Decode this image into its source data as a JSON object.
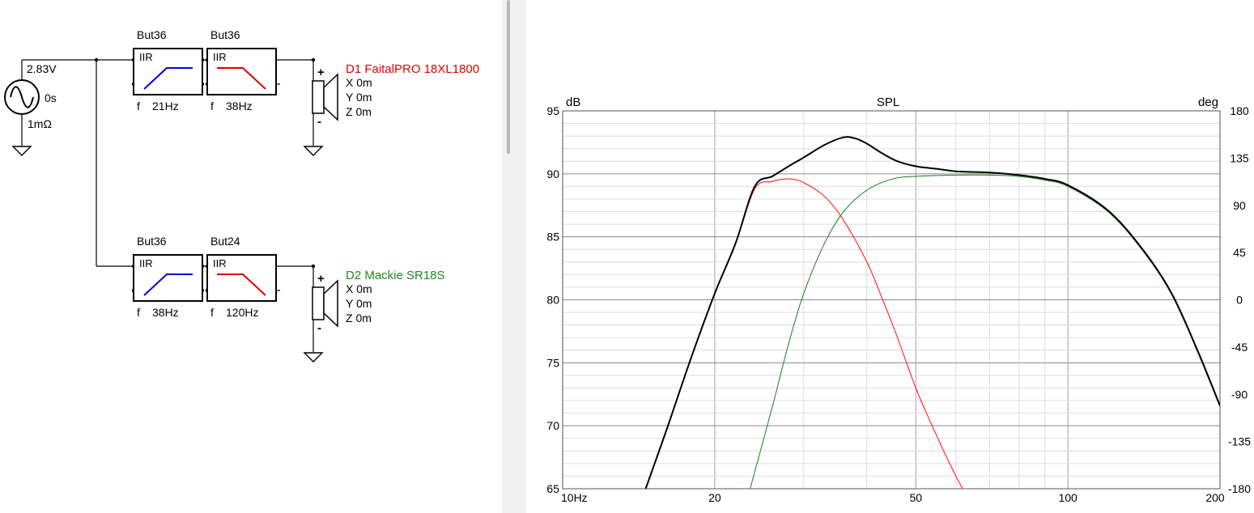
{
  "source": {
    "voltage": "2.83V",
    "delay": "0s",
    "impedance": "1mΩ"
  },
  "channels": [
    {
      "filters": [
        {
          "name": "But36",
          "type": "IIR",
          "shape": "highpass",
          "freq_label": "f",
          "freq": "21Hz"
        },
        {
          "name": "But36",
          "type": "IIR",
          "shape": "lowpass",
          "freq_label": "f",
          "freq": "38Hz"
        }
      ],
      "driver": {
        "label": "D1 FaitalPRO 18XL1800",
        "color": "#e00000",
        "x": "X 0m",
        "y": "Y 0m",
        "z": "Z 0m",
        "plus": "+",
        "minus": "-"
      }
    },
    {
      "filters": [
        {
          "name": "But36",
          "type": "IIR",
          "shape": "highpass",
          "freq_label": "f",
          "freq": "38Hz"
        },
        {
          "name": "But24",
          "type": "IIR",
          "shape": "lowpass",
          "freq_label": "f",
          "freq": "120Hz"
        }
      ],
      "driver": {
        "label": "D2 Mackie SR18S",
        "color": "#1e8a1e",
        "x": "X 0m",
        "y": "Y 0m",
        "z": "Z 0m",
        "plus": "+",
        "minus": "-"
      }
    }
  ],
  "colors": {
    "highpass": "#0000dd",
    "lowpass": "#dd0000",
    "sum": "#000000",
    "d1": "#ff2020",
    "d2": "#2a8a2a"
  },
  "chart_data": {
    "type": "line",
    "title": "SPL",
    "ylabel": "dB",
    "y2label": "deg",
    "xscale": "log",
    "xlim": [
      10,
      200
    ],
    "ylim": [
      65,
      95
    ],
    "y2lim": [
      -180,
      180
    ],
    "xticks": [
      {
        "v": 10,
        "label": "10Hz"
      },
      {
        "v": 20,
        "label": "20"
      },
      {
        "v": 50,
        "label": "50"
      },
      {
        "v": 100,
        "label": "100"
      },
      {
        "v": 200,
        "label": "200"
      }
    ],
    "yticks": [
      95,
      90,
      85,
      80,
      75,
      70,
      65
    ],
    "y2ticks": [
      "180",
      "135",
      "90",
      "45",
      "0",
      "-45",
      "-90",
      "-135",
      "-180"
    ],
    "grid": true,
    "series": [
      {
        "key": "d1",
        "x": [
          14.6,
          16,
          18,
          20,
          22,
          24,
          26,
          28,
          30,
          33,
          36,
          40,
          43,
          46,
          50,
          55,
          60,
          63
        ],
        "y": [
          65,
          69.5,
          75.5,
          80.5,
          84.5,
          88.8,
          89.4,
          89.6,
          89.3,
          88.2,
          86.3,
          83,
          80,
          77,
          73,
          69.2,
          66,
          64.5
        ]
      },
      {
        "key": "d2",
        "x": [
          23.5,
          26,
          28,
          30,
          33,
          36,
          40,
          45,
          50,
          60,
          70,
          80,
          90,
          100,
          120,
          140,
          160,
          180,
          200
        ],
        "y": [
          65,
          71.5,
          76.5,
          80.5,
          84.5,
          87,
          88.7,
          89.6,
          89.8,
          89.9,
          89.9,
          89.8,
          89.5,
          89,
          87,
          84,
          80.5,
          76,
          71.5
        ]
      },
      {
        "key": "sum",
        "x": [
          14.6,
          16,
          18,
          20,
          22,
          24,
          26,
          28,
          30,
          33,
          36,
          38,
          40,
          43,
          46,
          50,
          55,
          60,
          70,
          80,
          90,
          100,
          120,
          140,
          160,
          180,
          200
        ],
        "y": [
          65,
          69.5,
          75.5,
          80.5,
          84.5,
          89,
          89.8,
          90.6,
          91.3,
          92.3,
          92.9,
          92.8,
          92.4,
          91.6,
          91,
          90.6,
          90.4,
          90.2,
          90.1,
          89.9,
          89.6,
          89.1,
          87.1,
          84.1,
          80.6,
          76.1,
          71.6
        ]
      }
    ]
  }
}
